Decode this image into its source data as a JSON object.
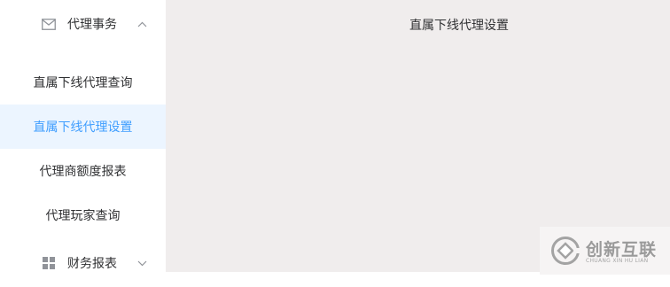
{
  "sidebar": {
    "agency_group": {
      "label": "代理事务",
      "icon": "envelope-icon",
      "expanded": true,
      "items": [
        {
          "label": "直属下线代理查询"
        },
        {
          "label": "直属下线代理设置",
          "active": true
        },
        {
          "label": "代理商额度报表"
        },
        {
          "label": "代理玩家查询"
        }
      ]
    },
    "finance_group": {
      "label": "财务报表",
      "icon": "grid-icon",
      "expanded": false
    }
  },
  "main": {
    "title": "直属下线代理设置"
  },
  "watermark": {
    "title": "创新互联",
    "subtitle": "CHUANG XIN HU LIAN"
  },
  "colors": {
    "active_text": "#409eff",
    "active_bg": "#ecf5ff",
    "main_bg": "#f0eded"
  }
}
